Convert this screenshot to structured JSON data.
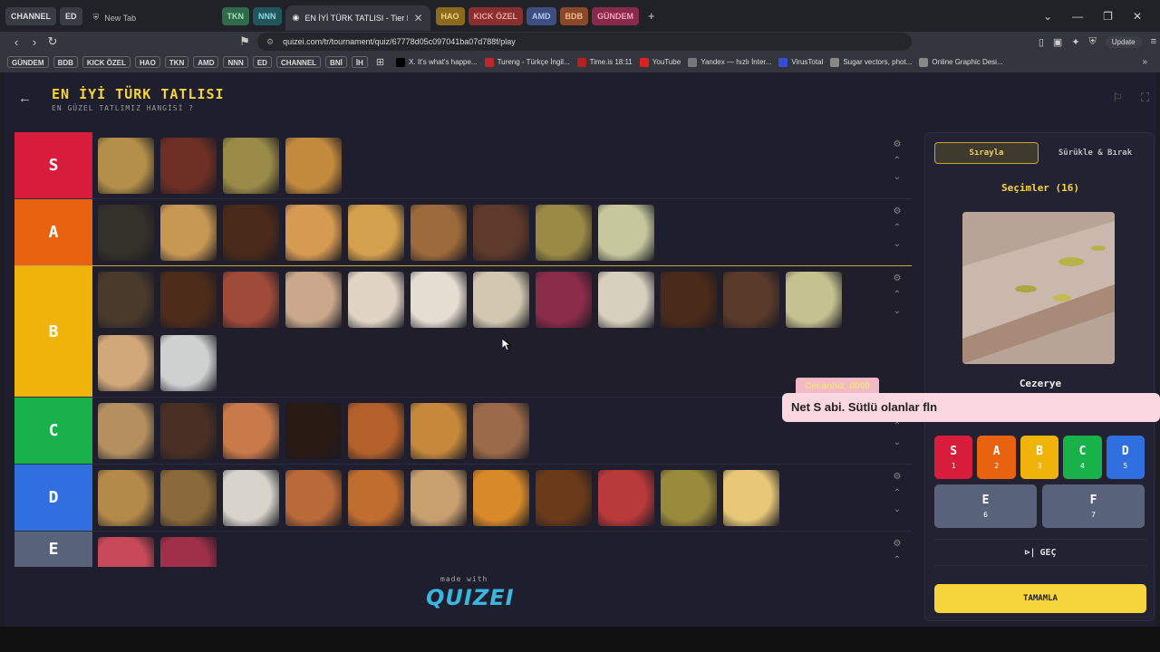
{
  "browser": {
    "tab_groups_left": [
      {
        "label": "CHANNEL",
        "color": "#3a3c44",
        "text": "#ddd"
      },
      {
        "label": "ED",
        "color": "#3a3c44",
        "text": "#ddd"
      }
    ],
    "new_tab_label": "New Tab",
    "tab_groups_mid": [
      {
        "label": "TKN",
        "color": "#2f6b4a",
        "text": "#9fe0b8"
      },
      {
        "label": "NNN",
        "color": "#22565d",
        "text": "#8ed8e0"
      }
    ],
    "active_tab_title": "EN İYİ TÜRK TATLISI - Tier List, K",
    "tab_groups_right": [
      {
        "label": "HAO",
        "color": "#8a6a1c",
        "text": "#f3d27a"
      },
      {
        "label": "KICK ÖZEL",
        "color": "#8a2f2f",
        "text": "#f2a0a0"
      },
      {
        "label": "AMD",
        "color": "#3d4f80",
        "text": "#b5c6f2"
      },
      {
        "label": "BDB",
        "color": "#8a4a2a",
        "text": "#f2b890"
      },
      {
        "label": "GÜNDEM",
        "color": "#8a2a4a",
        "text": "#f2a0be"
      }
    ],
    "new_tab_plus": "+",
    "url": "quizei.com/tr/tournament/quiz/67778d05c097041ba07d788f/play",
    "update_label": "Update",
    "bookmark_tags": [
      "GÜNDEM",
      "BDB",
      "KICK ÖZEL",
      "HAO",
      "TKN",
      "AMD",
      "NNN",
      "ED",
      "CHANNEL",
      "BNİ",
      "İH"
    ],
    "bookmarks": [
      {
        "label": "X. It's what's happe...",
        "color": "#000"
      },
      {
        "label": "Tureng - Türkçe İngil...",
        "color": "#c0272d"
      },
      {
        "label": "Time.is 18:11",
        "color": "#b52020"
      },
      {
        "label": "YouTube",
        "color": "#e02020"
      },
      {
        "label": "Yandex — hızlı İnter...",
        "color": "#777"
      },
      {
        "label": "VirusTotal",
        "color": "#3450d0"
      },
      {
        "label": "Sugar vectors, phot...",
        "color": "#888"
      },
      {
        "label": "Online Graphic Desi...",
        "color": "#888"
      }
    ]
  },
  "quiz": {
    "title": "EN İYİ TÜRK TATLISI",
    "subtitle": "EN GÜZEL TATLIMIZ HANGİSİ ?"
  },
  "tiers": [
    {
      "label": "S",
      "color": "#d81c3c",
      "height": 74,
      "items": [
        "#b38f49",
        "#6e2f25",
        "#9a8b48",
        "#c28a3c"
      ]
    },
    {
      "label": "A",
      "color": "#e8620f",
      "height": 74,
      "items": [
        "#34302a",
        "#c79854",
        "#4a2a1a",
        "#d69a52",
        "#d3a04e",
        "#9c6a3a",
        "#5d3a2a",
        "#9b8a46",
        "#c7c79d"
      ]
    },
    {
      "label": "B",
      "color": "#f0b30a",
      "height": 145,
      "highlight": true,
      "items": [
        "#4a3a2c",
        "#4e2c1a",
        "#a04a3a",
        "#c9a88c",
        "#e0d4c4",
        "#e6ddd2",
        "#d2c8b2",
        "#8a2c4a",
        "#d8d0be",
        "#4a2a1a",
        "#5a3a2a",
        "#c6c190",
        "#d0a87a",
        "#cfd0d0"
      ]
    },
    {
      "label": "C",
      "color": "#18b14a",
      "height": 74,
      "items": [
        "#b49060",
        "#4a3024",
        "#c87a4a",
        "#2a1a14",
        "#b4602a",
        "#c6893c",
        "#9a6a4a"
      ]
    },
    {
      "label": "D",
      "color": "#2f6fe0",
      "height": 74,
      "items": [
        "#b48a4a",
        "#8a6a3a",
        "#d8d4cc",
        "#b86a3a",
        "#c06e30",
        "#c8a070",
        "#d88a2a",
        "#6a3a1a",
        "#b83a3a",
        "#9a8a3c",
        "#e8c878"
      ]
    },
    {
      "label": "E",
      "color": "#58627a",
      "height": 40,
      "items": [
        "#c84a5a",
        "#a0304a"
      ]
    }
  ],
  "footer": {
    "made_with": "made with",
    "logo": "QUIZEI"
  },
  "panel": {
    "mode_sequential": "Sırayla",
    "mode_drag": "Sürükle & Bırak",
    "selections_title": "Seçimler (16)",
    "current_item": "Cezerye",
    "tier_buttons": [
      {
        "label": "S",
        "key": "1",
        "color": "#d81c3c"
      },
      {
        "label": "A",
        "key": "2",
        "color": "#e8620f"
      },
      {
        "label": "B",
        "key": "3",
        "color": "#f0b30a"
      },
      {
        "label": "C",
        "key": "4",
        "color": "#18b14a"
      },
      {
        "label": "D",
        "key": "5",
        "color": "#2f6fe0"
      }
    ],
    "tier_buttons_wide": [
      {
        "label": "E",
        "key": "6",
        "color": "#58627a"
      },
      {
        "label": "F",
        "key": "7",
        "color": "#58627a"
      }
    ],
    "skip_label": "GEÇ",
    "finish_label": "TAMAMLA"
  },
  "chat": {
    "username": "Cecanhız_0000",
    "message": "Net S abi. Sütlü olanlar fln"
  }
}
